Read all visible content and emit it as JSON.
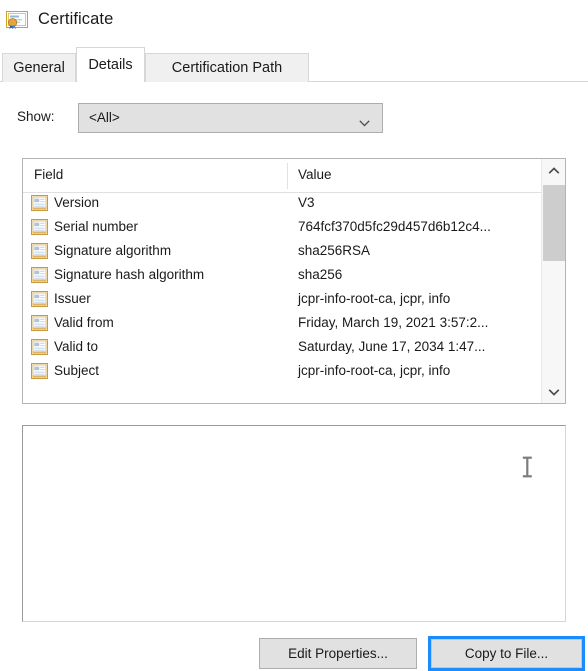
{
  "window": {
    "title": "Certificate",
    "icon": "certificate-icon"
  },
  "tabs": [
    {
      "label": "General",
      "selected": false
    },
    {
      "label": "Details",
      "selected": true
    },
    {
      "label": "Certification Path",
      "selected": false
    }
  ],
  "show": {
    "label": "Show:",
    "selected_value": "<All>",
    "arrow_icon": "chevron-down-icon",
    "options": [
      "<All>"
    ]
  },
  "details_list": {
    "columns": [
      "Field",
      "Value"
    ],
    "scrollbar": {
      "up_icon": "chevron-up-icon",
      "down_icon": "chevron-down-icon"
    },
    "rows": [
      {
        "icon": "certificate-field-icon",
        "field": "Version",
        "value": "V3"
      },
      {
        "icon": "certificate-field-icon",
        "field": "Serial number",
        "value": "764fcf370d5fc29d457d6b12c4..."
      },
      {
        "icon": "certificate-field-icon",
        "field": "Signature algorithm",
        "value": "sha256RSA"
      },
      {
        "icon": "certificate-field-icon",
        "field": "Signature hash algorithm",
        "value": "sha256"
      },
      {
        "icon": "certificate-field-icon",
        "field": "Issuer",
        "value": "jcpr-info-root-ca, jcpr, info"
      },
      {
        "icon": "certificate-field-icon",
        "field": "Valid from",
        "value": "Friday, March 19, 2021 3:57:2..."
      },
      {
        "icon": "certificate-field-icon",
        "field": "Valid to",
        "value": "Saturday, June 17, 2034 1:47..."
      },
      {
        "icon": "certificate-field-icon",
        "field": "Subject",
        "value": "jcpr-info-root-ca, jcpr, info"
      }
    ]
  },
  "detail_text": {
    "value": "",
    "cursor_icon": "text-ibeam-cursor"
  },
  "buttons": {
    "edit_properties": "Edit Properties...",
    "copy_to_file": "Copy to File..."
  },
  "colors": {
    "focus_blue": "#1a8cff",
    "button_face": "#e1e1e1",
    "border_gray": "#adadad",
    "icon_gold": "#e8a33d"
  }
}
